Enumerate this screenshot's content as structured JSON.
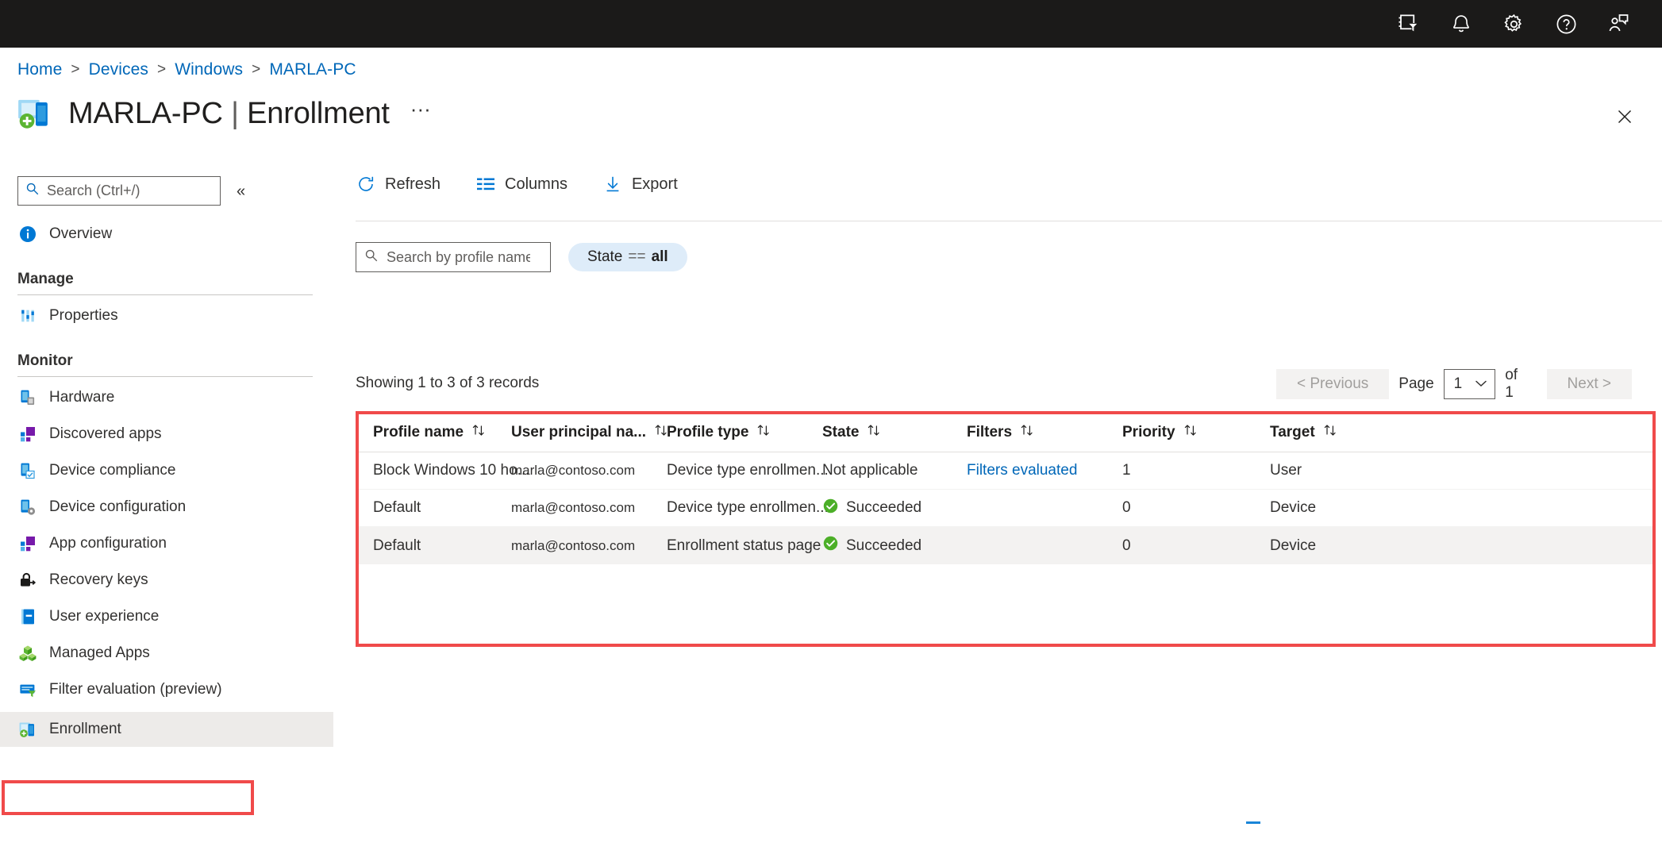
{
  "topbar": {
    "icons": [
      {
        "name": "filter-directory-icon",
        "title": "Directories + subscriptions"
      },
      {
        "name": "bell-icon",
        "title": "Notifications"
      },
      {
        "name": "gear-icon",
        "title": "Settings"
      },
      {
        "name": "help-question-icon",
        "title": "Help"
      },
      {
        "name": "feedback-person-icon",
        "title": "Feedback"
      }
    ]
  },
  "breadcrumb": {
    "items": [
      "Home",
      "Devices",
      "Windows",
      "MARLA-PC"
    ],
    "separator": ">"
  },
  "header": {
    "icon": "enrollment-device-icon",
    "device": "MARLA-PC",
    "divider": "|",
    "section": "Enrollment",
    "more_label": "···",
    "close_label": "Close"
  },
  "sidebar": {
    "search": {
      "placeholder": "Search (Ctrl+/)",
      "value": "",
      "icon": "search-icon"
    },
    "collapse_label": "«",
    "overview": {
      "label": "Overview",
      "icon": "info-circle-icon"
    },
    "groups": [
      {
        "title": "Manage",
        "items": [
          {
            "label": "Properties",
            "icon": "properties-icon"
          }
        ]
      },
      {
        "title": "Monitor",
        "items": [
          {
            "label": "Hardware",
            "icon": "hardware-device-icon"
          },
          {
            "label": "Discovered apps",
            "icon": "discovered-apps-icon"
          },
          {
            "label": "Device compliance",
            "icon": "device-compliance-icon"
          },
          {
            "label": "Device configuration",
            "icon": "device-configuration-icon"
          },
          {
            "label": "App configuration",
            "icon": "app-configuration-icon"
          },
          {
            "label": "Recovery keys",
            "icon": "lock-key-icon"
          },
          {
            "label": "User experience",
            "icon": "user-experience-icon"
          },
          {
            "label": "Managed Apps",
            "icon": "managed-apps-icon"
          },
          {
            "label": "Filter evaluation (preview)",
            "icon": "filter-evaluation-icon"
          },
          {
            "label": "Enrollment",
            "icon": "enrollment-icon",
            "selected": true,
            "highlighted": true
          }
        ]
      }
    ]
  },
  "toolbar": {
    "refresh_label": "Refresh",
    "columns_label": "Columns",
    "export_label": "Export"
  },
  "filters": {
    "profile_search_placeholder": "Search by profile name.",
    "profile_search_value": "",
    "state_pill": {
      "field": "State",
      "operator": "==",
      "value": "all"
    }
  },
  "pagination": {
    "records_text": "Showing 1 to 3 of 3 records",
    "previous_label": "< Previous",
    "page_label": "Page",
    "current_page": "1",
    "of_label": "of 1",
    "next_label": "Next >"
  },
  "table": {
    "columns": [
      {
        "label": "Profile name",
        "sort": "sortable"
      },
      {
        "label": "User principal na...",
        "sort": "sortable"
      },
      {
        "label": "Profile type",
        "sort": "sortable"
      },
      {
        "label": "State",
        "sort": "sortable"
      },
      {
        "label": "Filters",
        "sort": "sortable"
      },
      {
        "label": "Priority",
        "sort": "sortable"
      },
      {
        "label": "Target",
        "sort": "sortable"
      }
    ],
    "rows": [
      {
        "profile_name": "Block Windows 10 ho...",
        "upn": "marla@contoso.com",
        "profile_type": "Device type enrollmen...",
        "state": "Not applicable",
        "state_icon": "",
        "filters": "Filters evaluated",
        "filters_is_link": true,
        "priority": "1",
        "target": "User"
      },
      {
        "profile_name": "Default",
        "upn": "marla@contoso.com",
        "profile_type": "Device type enrollmen...",
        "state": "Succeeded",
        "state_icon": "success-check-icon",
        "filters": "",
        "filters_is_link": false,
        "priority": "0",
        "target": "Device"
      },
      {
        "profile_name": "Default",
        "upn": "marla@contoso.com",
        "profile_type": "Enrollment status page",
        "state": "Succeeded",
        "state_icon": "success-check-icon",
        "filters": "",
        "filters_is_link": false,
        "priority": "0",
        "target": "Device"
      }
    ]
  },
  "colors": {
    "accent_link": "#0067b8",
    "topbar_bg": "#1b1a19",
    "highlight_red": "#f04a4a",
    "success_green": "#4caf28",
    "pill_bg": "#deecf9"
  }
}
